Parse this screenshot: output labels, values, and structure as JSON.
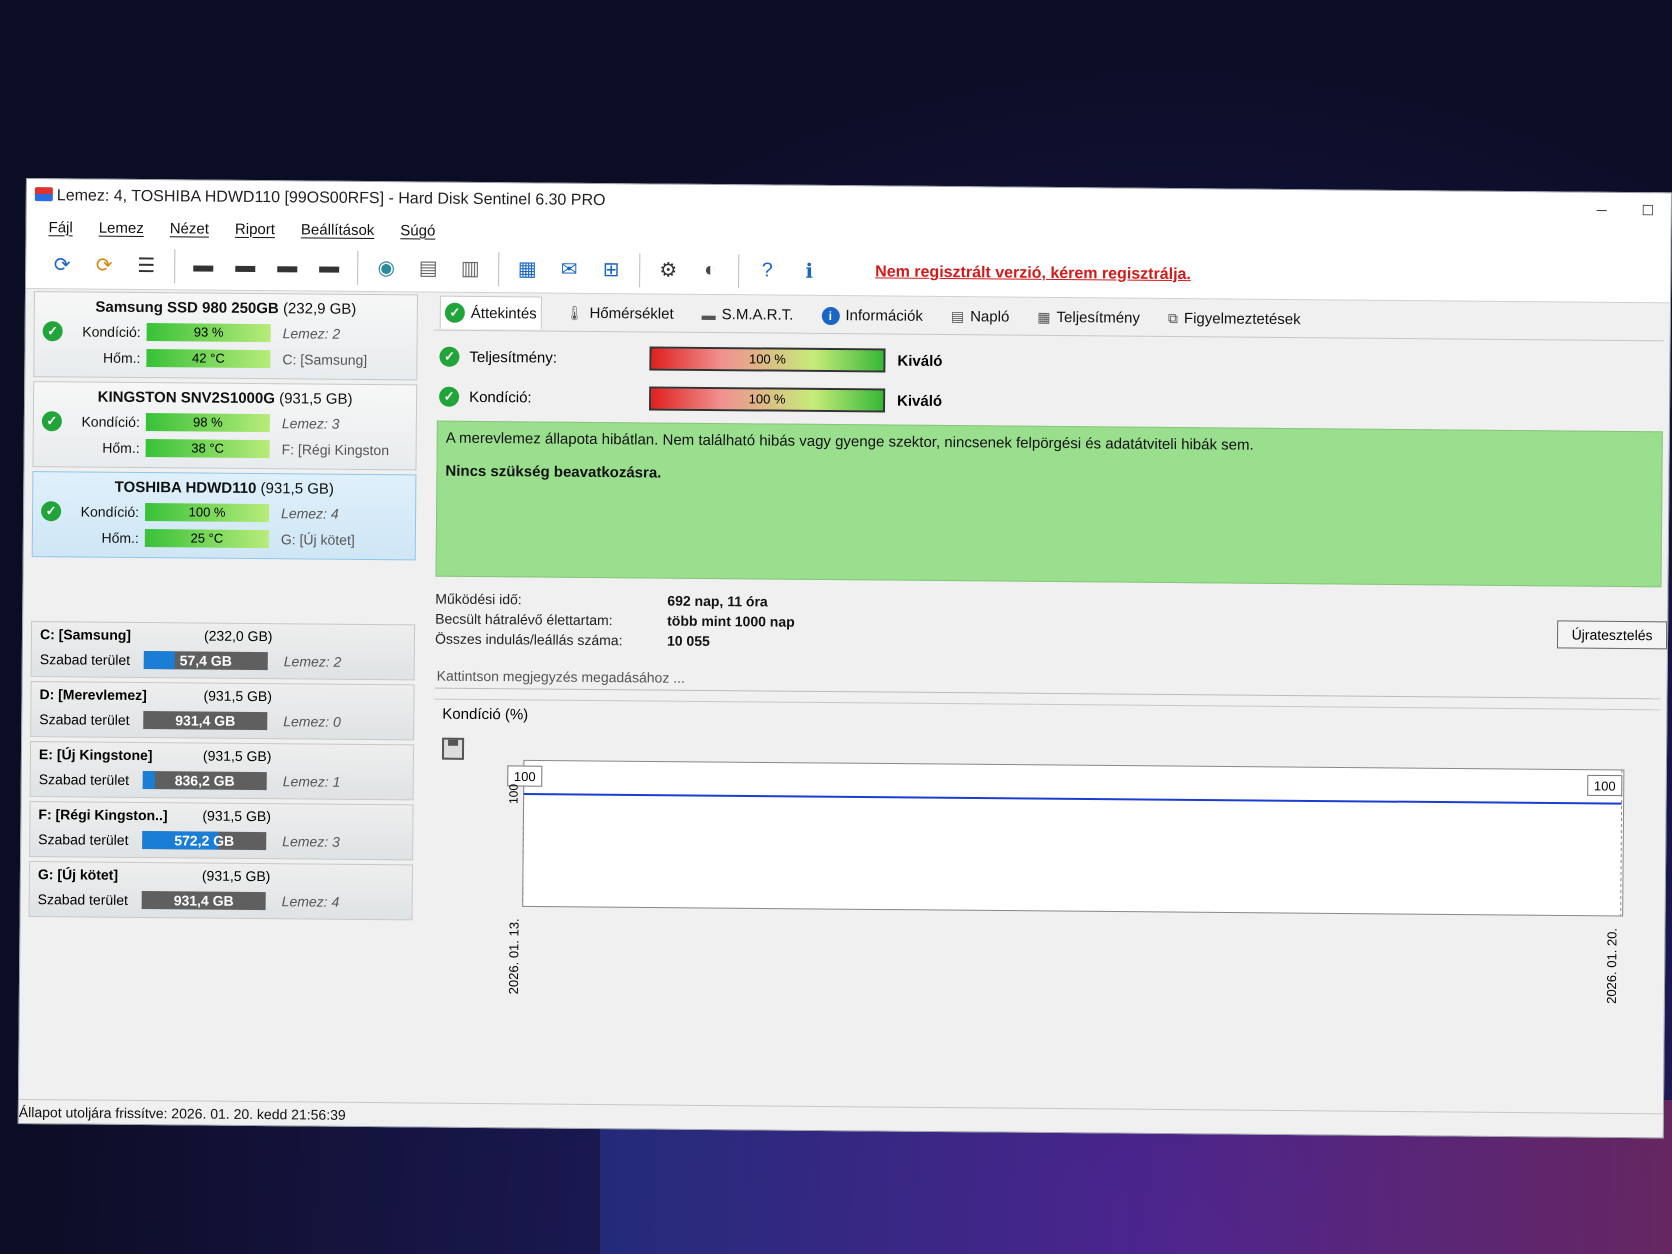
{
  "window": {
    "title": "Lemez: 4, TOSHIBA HDWD110 [99OS00RFS]  -  Hard Disk Sentinel 6.30 PRO"
  },
  "menu": [
    "Fájl",
    "Lemez",
    "Nézet",
    "Riport",
    "Beállítások",
    "Súgó"
  ],
  "toolbar": {
    "register_link": "Nem regisztrált verzió, kérem regisztrálja."
  },
  "disks": [
    {
      "name": "Samsung SSD 980 250GB",
      "size": "(232,9 GB)",
      "condition_label": "Kondíció:",
      "condition": "93 %",
      "disk_no": "Lemez: 2",
      "temp_label": "Hőm.:",
      "temp": "42 °C",
      "volume": "C: [Samsung]"
    },
    {
      "name": "KINGSTON SNV2S1000G",
      "size": "(931,5 GB)",
      "condition_label": "Kondíció:",
      "condition": "98 %",
      "disk_no": "Lemez: 3",
      "temp_label": "Hőm.:",
      "temp": "38 °C",
      "volume": "F: [Régi Kingston"
    },
    {
      "name": "TOSHIBA HDWD110",
      "size": "(931,5 GB)",
      "condition_label": "Kondíció:",
      "condition": "100 %",
      "disk_no": "Lemez: 4",
      "temp_label": "Hőm.:",
      "temp": "25 °C",
      "volume": "G: [Új kötet]"
    }
  ],
  "volumes": [
    {
      "name": "C: [Samsung]",
      "size": "(232,0 GB)",
      "free_label": "Szabad terület",
      "free": "57,4 GB",
      "free_fraction": 0.25,
      "disk": "Lemez: 2"
    },
    {
      "name": "D: [Merevlemez]",
      "size": "(931,5 GB)",
      "free_label": "Szabad terület",
      "free": "931,4 GB",
      "free_fraction": 0.0,
      "disk": "Lemez: 0"
    },
    {
      "name": "E: [Új Kingstone]",
      "size": "(931,5 GB)",
      "free_label": "Szabad terület",
      "free": "836,2 GB",
      "free_fraction": 0.1,
      "disk": "Lemez: 1"
    },
    {
      "name": "F: [Régi Kingston..]",
      "size": "(931,5 GB)",
      "free_label": "Szabad terület",
      "free": "572,2 GB",
      "free_fraction": 0.61,
      "disk": "Lemez: 3"
    },
    {
      "name": "G: [Új kötet]",
      "size": "(931,5 GB)",
      "free_label": "Szabad terület",
      "free": "931,4 GB",
      "free_fraction": 0.0,
      "disk": "Lemez: 4"
    }
  ],
  "tabs": [
    "Áttekintés",
    "Hőmérséklet",
    "S.M.A.R.T.",
    "Információk",
    "Napló",
    "Teljesítmény",
    "Figyelmeztetések"
  ],
  "metrics": {
    "performance": {
      "label": "Teljesítmény:",
      "value": "100 %",
      "status": "Kiváló"
    },
    "condition": {
      "label": "Kondíció:",
      "value": "100 %",
      "status": "Kiváló"
    }
  },
  "health": {
    "message": "A merevlemez állapota hibátlan. Nem található hibás vagy gyenge szektor, nincsenek felpörgési és adatátviteli hibák sem.",
    "action": "Nincs szükség beavatkozásra."
  },
  "info": [
    {
      "key": "Működési idő:",
      "value": "692 nap, 11 óra"
    },
    {
      "key": "Becsült hátralévő élettartam:",
      "value": "több mint 1000 nap"
    },
    {
      "key": "Összes indulás/leállás száma:",
      "value": "10 055"
    }
  ],
  "retest_button": "Újratesztelés",
  "note_placeholder": "Kattintson megjegyzés megadásához ...",
  "chart_data": {
    "type": "line",
    "title": "Kondíció  (%)",
    "x": [
      "2026. 01. 13.",
      "2026. 01. 20."
    ],
    "series": [
      {
        "values": [
          100,
          100
        ]
      }
    ],
    "point_labels": [
      "100",
      "100"
    ],
    "ylabel": "100"
  },
  "status_bar": "Állapot utoljára frissítve: 2026. 01. 20. kedd 21:56:39"
}
